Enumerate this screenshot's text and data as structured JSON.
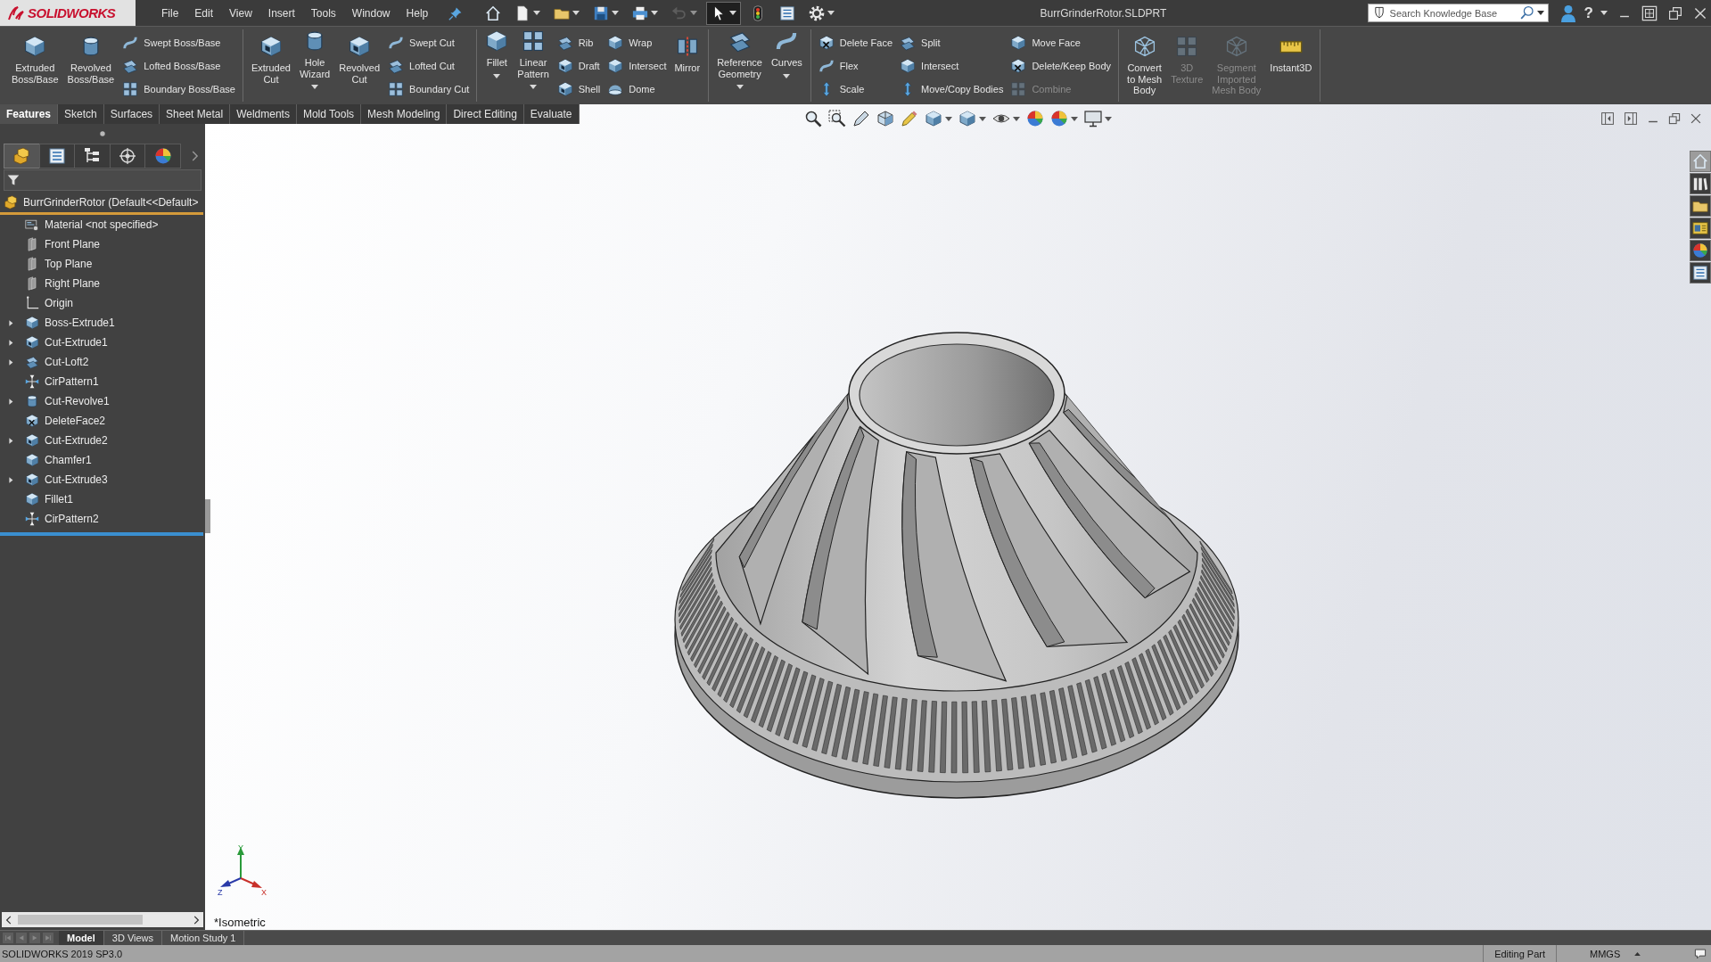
{
  "title_bar": {
    "logo": "SOLIDWORKS",
    "menu": [
      "File",
      "Edit",
      "View",
      "Insert",
      "Tools",
      "Window",
      "Help"
    ],
    "quick_access": [
      {
        "dropdown": false,
        "disabled": false,
        "selected": false
      },
      {
        "dropdown": true,
        "disabled": false,
        "selected": false
      },
      {
        "dropdown": true,
        "disabled": false,
        "selected": false
      },
      {
        "dropdown": true,
        "disabled": false,
        "selected": false
      },
      {
        "dropdown": true,
        "disabled": false,
        "selected": false
      },
      {
        "dropdown": true,
        "disabled": true,
        "selected": false
      },
      {
        "dropdown": true,
        "disabled": false,
        "selected": true
      },
      {
        "dropdown": false,
        "disabled": false,
        "selected": false
      },
      {
        "dropdown": false,
        "disabled": false,
        "selected": false
      },
      {
        "dropdown": true,
        "disabled": false,
        "selected": false
      }
    ],
    "document_title": "BurrGrinderRotor.SLDPRT",
    "search": {
      "placeholder": "Search Knowledge Base"
    },
    "help": "?"
  },
  "command_manager": {
    "groups": [
      {
        "items": [
          {
            "label": "Extruded\nBoss/Base",
            "kind": "large",
            "dropdown": false,
            "disabled": false
          },
          {
            "label": "Revolved\nBoss/Base",
            "kind": "large",
            "dropdown": false,
            "disabled": false
          },
          {
            "label": "Swept Boss/Base",
            "kind": "small",
            "dropdown": false,
            "disabled": false
          },
          {
            "label": "Lofted Boss/Base",
            "kind": "small",
            "dropdown": false,
            "disabled": false
          },
          {
            "label": "Boundary Boss/Base",
            "kind": "small",
            "dropdown": false,
            "disabled": false
          }
        ]
      },
      {
        "items": [
          {
            "label": "Extruded\nCut",
            "kind": "large",
            "dropdown": false,
            "disabled": false
          },
          {
            "label": "Hole\nWizard",
            "kind": "large",
            "dropdown": true,
            "disabled": false
          },
          {
            "label": "Revolved\nCut",
            "kind": "large",
            "dropdown": false,
            "disabled": false
          },
          {
            "label": "Swept Cut",
            "kind": "small",
            "dropdown": false,
            "disabled": false
          },
          {
            "label": "Lofted Cut",
            "kind": "small",
            "dropdown": false,
            "disabled": false
          },
          {
            "label": "Boundary Cut",
            "kind": "small",
            "dropdown": false,
            "disabled": false
          }
        ]
      },
      {
        "items": [
          {
            "label": "Fillet",
            "kind": "large",
            "dropdown": true,
            "disabled": false
          },
          {
            "label": "Linear\nPattern",
            "kind": "large",
            "dropdown": true,
            "disabled": false
          },
          {
            "label": "Rib",
            "kind": "small",
            "dropdown": false,
            "disabled": false
          },
          {
            "label": "Draft",
            "kind": "small",
            "dropdown": false,
            "disabled": false
          },
          {
            "label": "Shell",
            "kind": "small",
            "dropdown": false,
            "disabled": false
          },
          {
            "label": "Wrap",
            "kind": "small",
            "dropdown": false,
            "disabled": false
          },
          {
            "label": "Intersect",
            "kind": "small",
            "dropdown": false,
            "disabled": false
          },
          {
            "label": "Dome",
            "kind": "small",
            "dropdown": false,
            "disabled": false
          },
          {
            "label": "Mirror",
            "kind": "large",
            "dropdown": false,
            "disabled": false
          }
        ]
      },
      {
        "items": [
          {
            "label": "Reference\nGeometry",
            "kind": "large",
            "dropdown": true,
            "disabled": false
          },
          {
            "label": "Curves",
            "kind": "large",
            "dropdown": true,
            "disabled": false
          }
        ]
      },
      {
        "items": [
          {
            "label": "Delete Face",
            "kind": "small",
            "dropdown": false,
            "disabled": false
          },
          {
            "label": "Flex",
            "kind": "small",
            "dropdown": false,
            "disabled": false
          },
          {
            "label": "Scale",
            "kind": "small",
            "dropdown": false,
            "disabled": false
          },
          {
            "label": "Split",
            "kind": "small",
            "dropdown": false,
            "disabled": false
          },
          {
            "label": "Intersect",
            "kind": "small",
            "dropdown": false,
            "disabled": false
          },
          {
            "label": "Move/Copy Bodies",
            "kind": "small",
            "dropdown": false,
            "disabled": false
          },
          {
            "label": "Move Face",
            "kind": "small",
            "dropdown": false,
            "disabled": false
          },
          {
            "label": "Delete/Keep Body",
            "kind": "small",
            "dropdown": false,
            "disabled": false
          },
          {
            "label": "Combine",
            "kind": "small",
            "dropdown": false,
            "disabled": true
          }
        ]
      },
      {
        "items": [
          {
            "label": "Convert\nto Mesh\nBody",
            "kind": "large",
            "dropdown": false,
            "disabled": false
          },
          {
            "label": "3D\nTexture",
            "kind": "large",
            "dropdown": false,
            "disabled": true
          },
          {
            "label": "Segment\nImported\nMesh Body",
            "kind": "large",
            "dropdown": false,
            "disabled": true
          },
          {
            "label": "Instant3D",
            "kind": "large",
            "dropdown": false,
            "disabled": false
          }
        ]
      }
    ]
  },
  "tabs": [
    {
      "label": "Features",
      "selected": true
    },
    {
      "label": "Sketch",
      "selected": false
    },
    {
      "label": "Surfaces",
      "selected": false
    },
    {
      "label": "Sheet Metal",
      "selected": false
    },
    {
      "label": "Weldments",
      "selected": false
    },
    {
      "label": "Mold Tools",
      "selected": false
    },
    {
      "label": "Mesh Modeling",
      "selected": false
    },
    {
      "label": "Direct Editing",
      "selected": false
    },
    {
      "label": "Evaluate",
      "selected": false
    }
  ],
  "feature_manager": {
    "tabs": [
      {
        "selected": true
      },
      {
        "selected": false
      },
      {
        "selected": false
      },
      {
        "selected": false
      },
      {
        "selected": false
      }
    ],
    "tree": {
      "label": "BurrGrinderRotor (Default<<Default>",
      "kind": "part",
      "children": [
        {
          "label": "Material <not specified>",
          "kind": "material"
        },
        {
          "label": "Front Plane",
          "kind": "plane"
        },
        {
          "label": "Top Plane",
          "kind": "plane"
        },
        {
          "label": "Right Plane",
          "kind": "plane"
        },
        {
          "label": "Origin",
          "kind": "origin"
        },
        {
          "label": "Boss-Extrude1",
          "kind": "extrude",
          "expanded": false
        },
        {
          "label": "Cut-Extrude1",
          "kind": "cut",
          "expanded": false
        },
        {
          "label": "Cut-Loft2",
          "kind": "loft",
          "expanded": false
        },
        {
          "label": "CirPattern1",
          "kind": "pattern"
        },
        {
          "label": "Cut-Revolve1",
          "kind": "revolve",
          "expanded": false
        },
        {
          "label": "DeleteFace2",
          "kind": "delete-face"
        },
        {
          "label": "Cut-Extrude2",
          "kind": "cut",
          "expanded": false
        },
        {
          "label": "Chamfer1",
          "kind": "chamfer"
        },
        {
          "label": "Cut-Extrude3",
          "kind": "cut",
          "expanded": false
        },
        {
          "label": "Fillet1",
          "kind": "fillet"
        },
        {
          "label": "CirPattern2",
          "kind": "pattern"
        }
      ]
    }
  },
  "graphics": {
    "view_toolbar": [
      {
        "dropdown": false
      },
      {
        "dropdown": false
      },
      {
        "dropdown": false
      },
      {
        "dropdown": false
      },
      {
        "dropdown": false
      },
      {
        "dropdown": true
      },
      {
        "dropdown": true
      },
      {
        "dropdown": true
      },
      {
        "dropdown": false
      },
      {
        "dropdown": true
      },
      {
        "dropdown": true
      }
    ],
    "task_pane": [
      {
        "selected": true
      },
      {
        "selected": false
      },
      {
        "selected": false
      },
      {
        "selected": false
      },
      {
        "selected": false
      },
      {
        "selected": false
      }
    ],
    "triad": [
      "Y",
      "X",
      "Z"
    ],
    "view_name": "*Isometric"
  },
  "bottom_tabs": [
    {
      "label": "Model",
      "selected": true
    },
    {
      "label": "3D Views",
      "selected": false
    },
    {
      "label": "Motion Study 1",
      "selected": false
    }
  ],
  "status_bar": {
    "version": "SOLIDWORKS 2019 SP3.0",
    "mode": "Editing Part",
    "units": "MMGS"
  }
}
